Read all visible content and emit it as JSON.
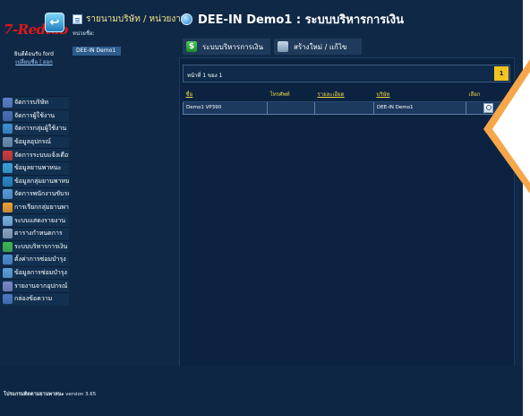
{
  "header": {
    "logo_text": "7-Redtab",
    "home_icon": "home-icon",
    "user_name": "ยินดีต้อนรับ ford",
    "user_links": "เปลี่ยนชื่อ | ออก",
    "org_heading": "รายนามบริษัท / หน่วยงาน",
    "org_label": "หน่วยชื่อ:",
    "org_value": "DEE-IN Demo1",
    "page_title": "DEE-IN Demo1 : ระบบบริหารการเงิน"
  },
  "tabs": [
    {
      "label": "ระบบบริหารการเงิน",
      "icon": "dollar-icon"
    },
    {
      "label": "สร้างใหม่ / แก้ไข",
      "icon": "edit-icon"
    }
  ],
  "sidebar": {
    "items": [
      {
        "label": "จัดการบริษัท",
        "color": "#5b7fc8"
      },
      {
        "label": "จัดการผู้ใช้งาน",
        "color": "#4a6fb5"
      },
      {
        "label": "จัดการกลุ่มผู้ใช้งาน",
        "color": "#3f8fd2"
      },
      {
        "label": "ข้อมูลอุปกรณ์",
        "color": "#6c8fb2"
      },
      {
        "label": "จัดการระบบแจ้งเตือน",
        "color": "#d23a3a"
      },
      {
        "label": "ข้อมูลยานพาหนะ",
        "color": "#3aa3d8"
      },
      {
        "label": "ข้อมูลกลุ่มยานพาหนะ",
        "color": "#2a86c8"
      },
      {
        "label": "จัดการพนักงานขับรถ",
        "color": "#5a9ad8"
      },
      {
        "label": "การเรียกกลุ่มยานพาหนะ",
        "color": "#f0a030"
      },
      {
        "label": "ระบบแสดงรายงาน",
        "color": "#7ab0e0"
      },
      {
        "label": "ตารางกำหนดการ",
        "color": "#8aa4c0"
      },
      {
        "label": "ระบบบริหารการเงิน",
        "color": "#3cb850"
      },
      {
        "label": "ตั้งค่าการซ่อมบำรุง",
        "color": "#4d8fd0"
      },
      {
        "label": "ข้อมูลการซ่อมบำรุง",
        "color": "#5aa0d8"
      },
      {
        "label": "รายงานจากอุปกรณ์",
        "color": "#7a88c8"
      },
      {
        "label": "กล่องข้อความ",
        "color": "#4a7ac0"
      }
    ]
  },
  "main": {
    "pager_text": "หน้าที่ 1 ของ 1",
    "page_number": "1",
    "columns": {
      "name": "ชื่อ",
      "phone": "โทรศัพท์",
      "detail": "รายละเอียด",
      "company": "บริษัท",
      "action": "เลือก"
    },
    "rows": [
      {
        "name": "Demo1 VP390",
        "phone": "",
        "detail": "",
        "company": "DEE-IN Demo1",
        "action_icon": "search-icon"
      }
    ]
  },
  "footer": {
    "version_label": "โปรแกรมติดตามยานพาหนะ",
    "version_text": "version 3.65"
  }
}
